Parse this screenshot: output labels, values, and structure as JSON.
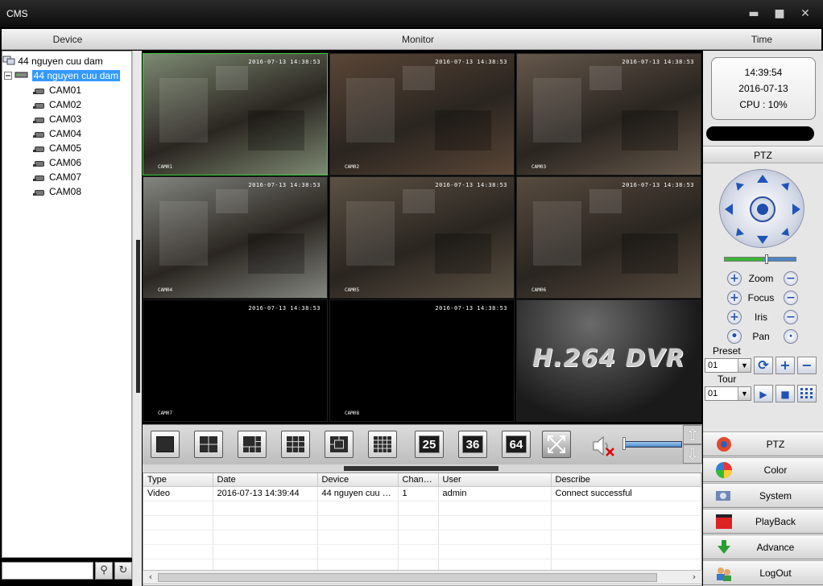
{
  "window": {
    "title": "CMS",
    "controls": {
      "minimize": "▬",
      "maximize": "■",
      "close": "✕"
    }
  },
  "headers": {
    "device": "Device",
    "monitor": "Monitor",
    "time": "Time"
  },
  "device_tree": {
    "root": "44 nguyen cuu dam",
    "device": "44 nguyen cuu dam",
    "cameras": [
      "CAM01",
      "CAM02",
      "CAM03",
      "CAM04",
      "CAM05",
      "CAM06",
      "CAM07",
      "CAM08"
    ]
  },
  "monitor": {
    "osd_time": "2016-07-13 14:38:53",
    "tiles": [
      {
        "label": "CAM01",
        "scene": "#7d8a72"
      },
      {
        "label": "CAM02",
        "scene": "#5a4636"
      },
      {
        "label": "CAM03",
        "scene": "#65584b"
      },
      {
        "label": "CAM04",
        "scene": "#83867f"
      },
      {
        "label": "CAM05",
        "scene": "#5c5244"
      },
      {
        "label": "CAM06",
        "scene": "#574b3f"
      },
      {
        "label": "CAM07",
        "scene": "#000000"
      },
      {
        "label": "CAM08",
        "scene": "#000000"
      }
    ],
    "logo_text": "H.264 DVR"
  },
  "layout_bar": {
    "buttons": [
      "1",
      "4",
      "6",
      "8",
      "9",
      "13",
      "16",
      "25",
      "36",
      "64",
      "full"
    ],
    "numbers": {
      "25": "25",
      "36": "36",
      "64": "64"
    }
  },
  "log": {
    "columns": [
      "Type",
      "Date",
      "Device",
      "Chan…",
      "User",
      "Describe"
    ],
    "rows": [
      [
        "Video",
        "2016-07-13 14:39:44",
        "44 nguyen cuu …",
        "1",
        "admin",
        "Connect successful"
      ]
    ]
  },
  "status": {
    "time": "14:39:54",
    "date": "2016-07-13",
    "cpu": "CPU : 10%"
  },
  "ptz": {
    "header": "PTZ",
    "controls": [
      "Zoom",
      "Focus",
      "Iris",
      "Pan"
    ],
    "preset_label": "Preset",
    "preset_value": "01",
    "tour_label": "Tour",
    "tour_value": "01"
  },
  "menu": [
    {
      "label": "PTZ",
      "icon": "ptz-icon"
    },
    {
      "label": "Color",
      "icon": "color-icon"
    },
    {
      "label": "System",
      "icon": "system-icon"
    },
    {
      "label": "PlayBack",
      "icon": "playback-icon"
    },
    {
      "label": "Advance",
      "icon": "advance-icon"
    },
    {
      "label": "LogOut",
      "icon": "logout-icon"
    }
  ]
}
